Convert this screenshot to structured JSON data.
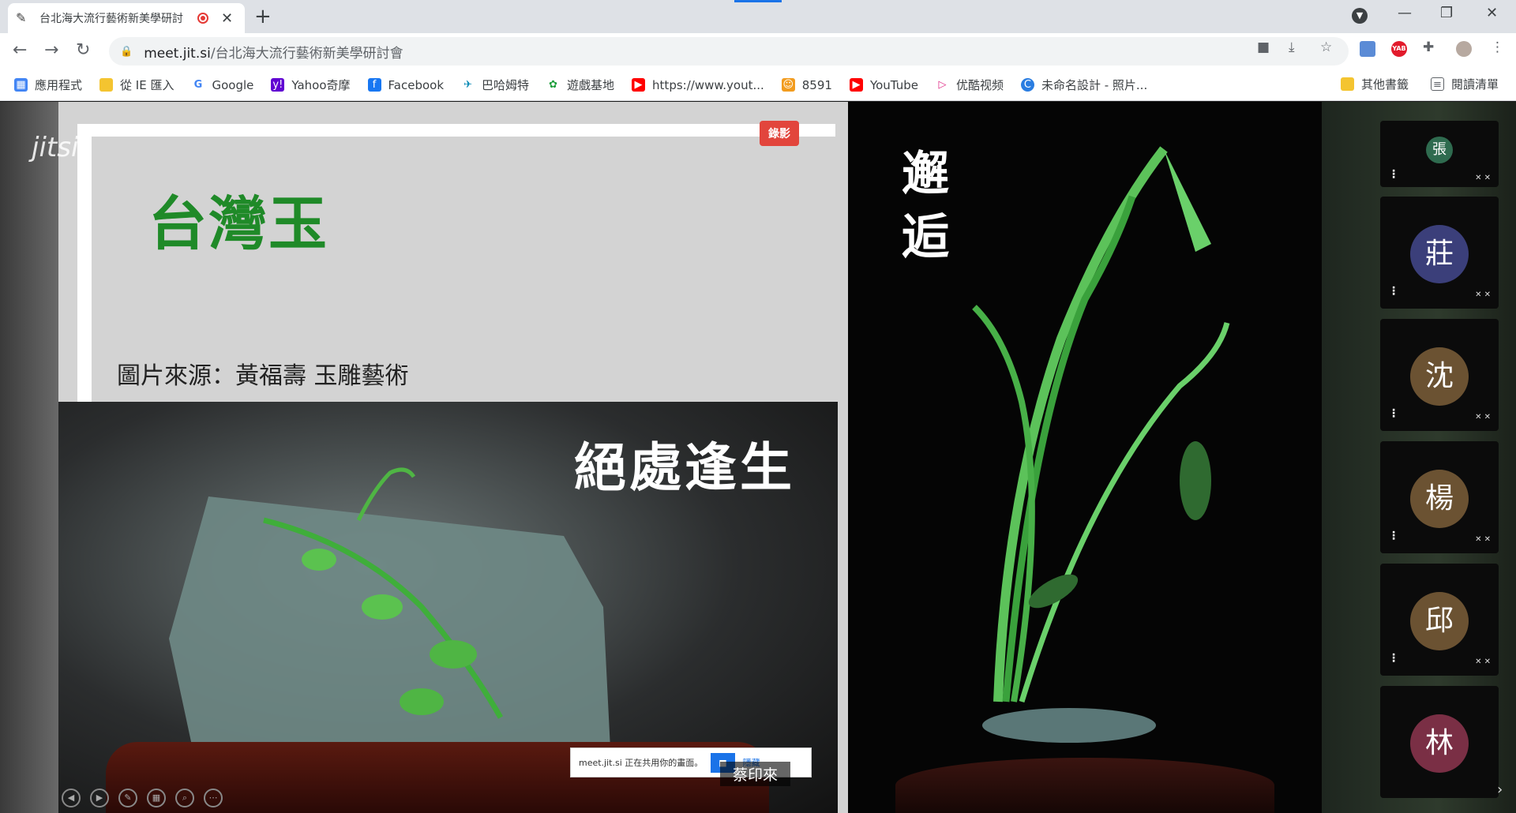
{
  "browser": {
    "tab_title": "台北海大流行藝術新美學研討",
    "window_controls": {
      "minimize": "—",
      "restore": "❐",
      "close": "✕"
    }
  },
  "address_bar": {
    "host": "meet.jit.si",
    "path": "/台北海大流行藝術新美學研討會"
  },
  "bookmarks": [
    {
      "label": "應用程式",
      "icon": "apps-grid-icon",
      "color": "#4285f4"
    },
    {
      "label": "從 IE 匯入",
      "icon": "folder-icon",
      "color": "#f4c430"
    },
    {
      "label": "Google",
      "icon": "google-icon",
      "color": "#4285f4"
    },
    {
      "label": "Yahoo奇摩",
      "icon": "yahoo-icon",
      "color": "#6001d2"
    },
    {
      "label": "Facebook",
      "icon": "facebook-icon",
      "color": "#1877f2"
    },
    {
      "label": "巴哈姆特",
      "icon": "bahamut-icon",
      "color": "#0a8ab5"
    },
    {
      "label": "遊戲基地",
      "icon": "gamebase-icon",
      "color": "#1a9e3a"
    },
    {
      "label": "https://www.yout...",
      "icon": "youtube-icon",
      "color": "#ff0000"
    },
    {
      "label": "8591",
      "icon": "8591-icon",
      "color": "#f29c1f"
    },
    {
      "label": "YouTube",
      "icon": "youtube-icon",
      "color": "#ff0000"
    },
    {
      "label": "优酷视频",
      "icon": "youku-icon",
      "color": "#e02a86"
    },
    {
      "label": "未命名設計 - 照片...",
      "icon": "canva-icon",
      "color": "#2a7de1"
    }
  ],
  "bookmarks_right": {
    "other": "其他書籤",
    "reading_list": "閱讀清單"
  },
  "meeting": {
    "logo": "jitsi",
    "recording_badge": "錄影",
    "slide_title": "台灣玉",
    "slide_source": "圖片來源：黃福壽 玉雕藝術",
    "photo1_caption": "絕處逢生",
    "photo2_caption": "邂逅",
    "share_toast": "meet.jit.si 正在共用你的畫面。",
    "share_hide": "隱藏",
    "speaker_name": "蔡印來",
    "colors": {
      "title_green": "#1f8a28",
      "record_red": "#e2453c"
    }
  },
  "participants": [
    {
      "initial": "張",
      "color": "#2f6b4f"
    },
    {
      "initial": "莊",
      "color": "#3b3f7a"
    },
    {
      "initial": "沈",
      "color": "#6b5232"
    },
    {
      "initial": "楊",
      "color": "#6b5232"
    },
    {
      "initial": "邱",
      "color": "#6b5232"
    },
    {
      "initial": "林",
      "color": "#7a2f45"
    }
  ]
}
